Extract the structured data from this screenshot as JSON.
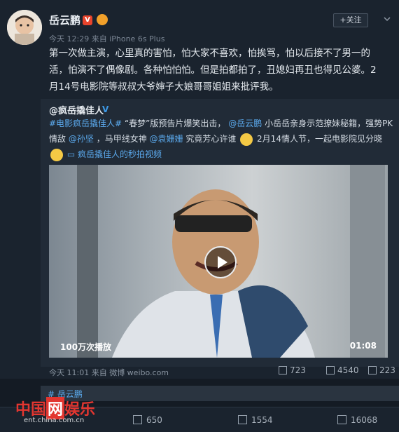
{
  "post": {
    "author": "岳云鹏",
    "verified_badge": "V",
    "follow_label": "+关注",
    "meta": "今天 12:29 来自 iPhone 6s Plus",
    "text": "第一次做主演，心里真的害怕，怕大家不喜欢，怕挨骂，怕以后接不了男一的活，怕演不了偶像剧。各种怕怕怕。但是拍都拍了，丑媳妇再丑也得见公婆。2月14号电影院等叔叔大爷婶子大娘哥哥姐姐来批评我。"
  },
  "repost": {
    "author": "@疯岳撬佳人",
    "text_parts": {
      "tag": "#电影疯岳撬佳人#",
      "p1": "“春梦”版预告片爆笑出击，",
      "mention1": "@岳云鹏",
      "p2": " 小岳岳亲身示范撩妹秘籍，强势PK情敌",
      "mention2": "@孙坚",
      "p3": "，马甲线女神",
      "mention3": "@袁姗姗",
      "p4": " 究竟芳心许谁",
      "p5": "2月14情人节，一起电影院见分晓",
      "link": "疯岳撬佳人的秒拍视频"
    },
    "video": {
      "views": "100万次播放",
      "duration": "01:08"
    },
    "meta": "今天 11:01 来自 微博 weibo.com",
    "stats": {
      "reposts": "723",
      "comments": "4540",
      "likes": "223"
    }
  },
  "topic": "# 岳云鹏",
  "bottom": {
    "reposts": "650",
    "comments": "1554",
    "likes": "16068"
  },
  "watermark": {
    "main_a": "中国",
    "main_b": "网",
    "main_c": "娱乐",
    "sub": "ent.china.com.cn"
  },
  "colors": {
    "link": "#5ba9ec",
    "bg": "#1a232e",
    "accent": "#e8442c"
  }
}
